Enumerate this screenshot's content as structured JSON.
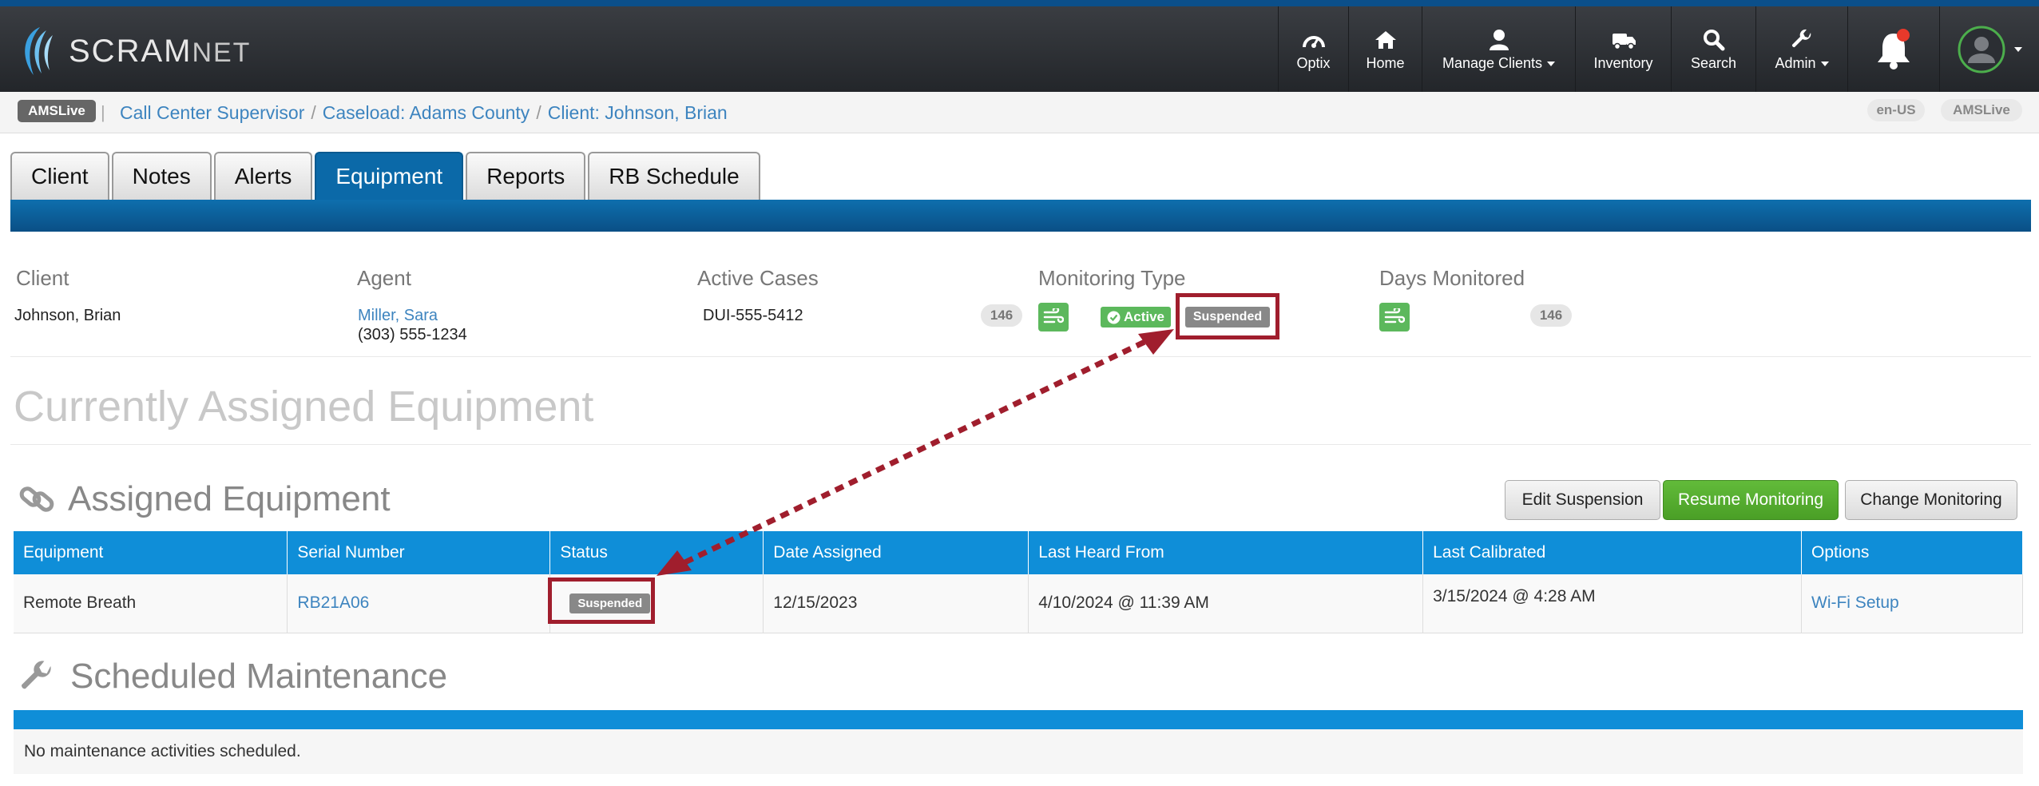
{
  "app": {
    "logo_text": "SCRAM",
    "logo_suffix": "NET"
  },
  "nav": {
    "items": [
      {
        "label": "Optix",
        "icon": "dashboard-icon"
      },
      {
        "label": "Home",
        "icon": "home-icon"
      },
      {
        "label": "Manage Clients",
        "icon": "user-icon"
      },
      {
        "label": "Inventory",
        "icon": "truck-icon"
      },
      {
        "label": "Search",
        "icon": "search-icon"
      },
      {
        "label": "Admin",
        "icon": "wrench-icon"
      }
    ]
  },
  "crumbbar": {
    "env_badge": "AMSLive",
    "breadcrumbs": [
      "Call Center Supervisor",
      "Caseload: Adams County",
      "Client: Johnson, Brian"
    ],
    "locale": "en-US",
    "env_right": "AMSLive"
  },
  "tabs": [
    "Client",
    "Notes",
    "Alerts",
    "Equipment",
    "Reports",
    "RB Schedule"
  ],
  "active_tab": "Equipment",
  "summary": {
    "client_header": "Client",
    "client_name": "Johnson, Brian",
    "agent_header": "Agent",
    "agent_name": "Miller, Sara",
    "agent_phone": "(303) 555-1234",
    "cases_header": "Active Cases",
    "case_id": "DUI-555-5412",
    "case_count": "146",
    "monitoring_header": "Monitoring Type",
    "active_label": "Active",
    "suspended_label": "Suspended",
    "days_header": "Days Monitored",
    "days_count": "146"
  },
  "page_title": "Currently Assigned Equipment",
  "assigned": {
    "title": "Assigned Equipment",
    "buttons": {
      "edit": "Edit Suspension",
      "resume": "Resume Monitoring",
      "change": "Change Monitoring"
    },
    "columns": [
      "Equipment",
      "Serial Number",
      "Status",
      "Date Assigned",
      "Last Heard From",
      "Last Calibrated",
      "Options"
    ],
    "row": {
      "equipment": "Remote Breath",
      "serial": "RB21A06",
      "status": "Suspended",
      "date_assigned": "12/15/2023",
      "last_heard": "4/10/2024 @ 11:39 AM",
      "last_calibrated": "3/15/2024 @ 4:28 AM",
      "option": "Wi-Fi Setup"
    }
  },
  "maintenance": {
    "title": "Scheduled Maintenance",
    "empty_text": "No maintenance activities scheduled."
  },
  "colors": {
    "accent": "#0f8ed8",
    "success": "#5cb85c",
    "annotation": "#a01e2d"
  }
}
